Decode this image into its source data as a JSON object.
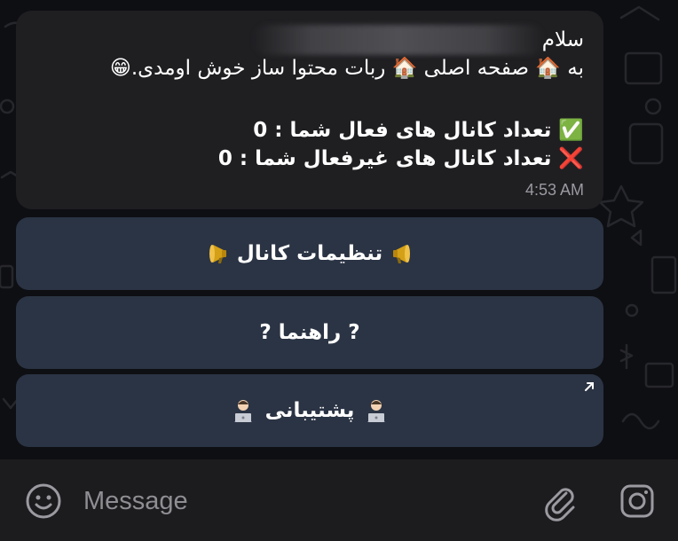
{
  "message": {
    "greeting": "سلام",
    "line2": "به 🏠 صفحه اصلی 🏠 ربات محتوا ساز خوش اومدی.😁",
    "active_channels": "✅ تعداد کانال های فعال شما : 0",
    "inactive_channels": "❌ تعداد کانال های غیرفعال شما : 0",
    "time": "4:53 AM"
  },
  "keyboard": {
    "channel_settings": "تنظیمات کانال",
    "help": "? راهنما ?",
    "support": "پشتیبانی"
  },
  "input": {
    "placeholder": "Message"
  },
  "icons": {
    "megaphone": "megaphone-icon",
    "technologist": "technologist-icon",
    "emoji": "smiley-icon",
    "attach": "paperclip-icon",
    "camera": "camera-icon",
    "corner": "arrow-up-right-icon"
  },
  "colors": {
    "bubble": "#1f1f22",
    "button": "#2b3444",
    "input_bar": "#1c1c1f",
    "time": "#9a9aa0"
  }
}
